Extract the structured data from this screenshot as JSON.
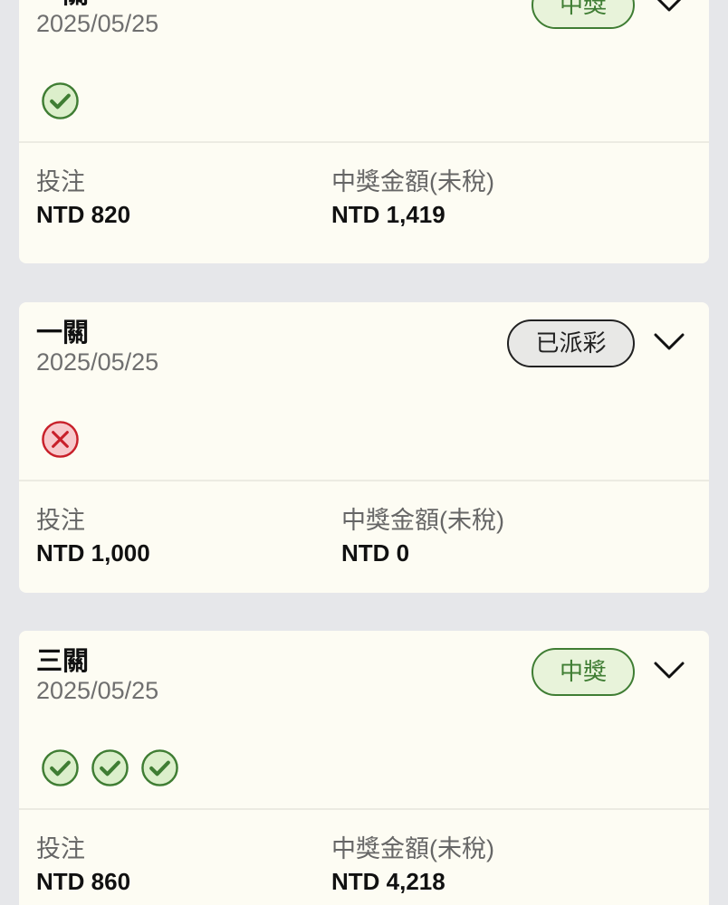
{
  "colors": {
    "page_bg": "#e6e7ea",
    "card_bg": "#fdfcf3",
    "won_green": "#3f7d33",
    "lost_red": "#c8202a"
  },
  "labels": {
    "stake": "投注",
    "payout": "中獎金額(未稅)"
  },
  "bets": [
    {
      "type": "一關",
      "date": "2025/05/25",
      "status": "中獎",
      "legs": [
        "check-circle-icon"
      ],
      "stake": "NTD 820",
      "payout": "NTD 1,419"
    },
    {
      "type": "一關",
      "date": "2025/05/25",
      "status": "已派彩",
      "legs": [
        "cross-circle-icon"
      ],
      "stake": "NTD 1,000",
      "payout": "NTD 0"
    },
    {
      "type": "三關",
      "date": "2025/05/25",
      "status": "中獎",
      "legs": [
        "check-circle-icon",
        "check-circle-icon",
        "check-circle-icon"
      ],
      "stake": "NTD 860",
      "payout": "NTD 4,218"
    }
  ]
}
